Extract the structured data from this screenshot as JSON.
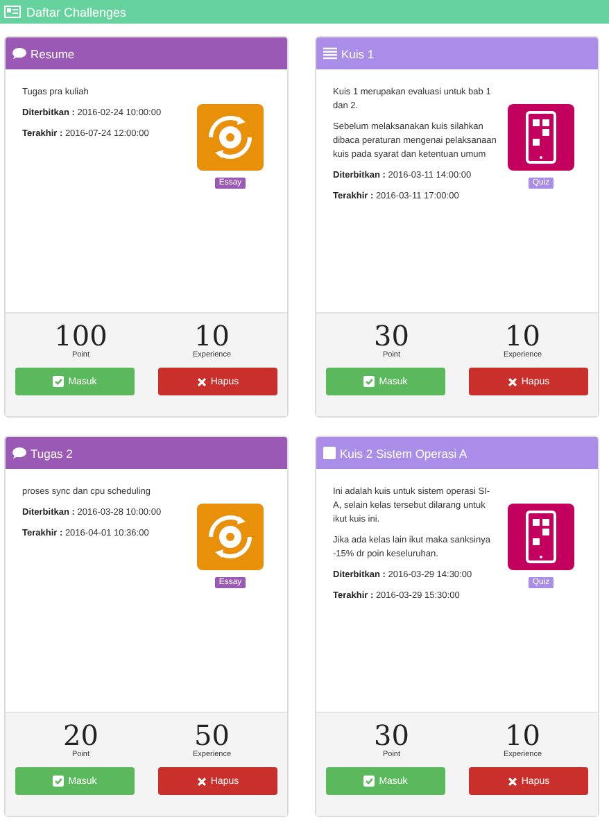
{
  "page_title": "Daftar Challenges",
  "cards": [
    {
      "header": {
        "kind": "comment",
        "title": "Resume"
      },
      "kind": "essay",
      "paragraphs": [
        "Tugas pra kuliah"
      ],
      "published": "**Diterbitkan :** 2016-02-24 10:00:00",
      "deadline": "**Terakhir :** 2016-07-24 12:00:00",
      "badge": "Essay",
      "points": "100",
      "points_label": "Point",
      "experience": "10",
      "experience_label": "Experience",
      "buttons": [
        "Masuk",
        "Hapus"
      ]
    },
    {
      "header": {
        "kind": "list",
        "title": "Kuis 1"
      },
      "kind": "quiz",
      "paragraphs": [
        "Kuis 1 merupakan evaluasi untuk bab 1 dan 2.",
        "Sebelum melaksanakan kuis silahkan dibaca peraturan mengenai pelaksanaan kuis pada syarat dan ketentuan umum"
      ],
      "published": "**Diterbitkan :** 2016-03-11 14:00:00",
      "deadline": "**Terakhir :** 2016-03-11 17:00:00",
      "badge": "Quiz",
      "points": "30",
      "points_label": "Point",
      "experience": "10",
      "experience_label": "Experience",
      "buttons": [
        "Masuk",
        "Hapus"
      ]
    },
    {
      "header": {
        "kind": "comment",
        "title": "Tugas 2"
      },
      "kind": "essay",
      "paragraphs": [
        "proses sync dan cpu scheduling"
      ],
      "published": "**Diterbitkan :** 2016-03-28 10:00:00",
      "deadline": "**Terakhir :** 2016-04-01 10:36:00",
      "badge": "Essay",
      "points": "20",
      "points_label": "Point",
      "experience": "50",
      "experience_label": "Experience",
      "buttons": [
        "Masuk",
        "Hapus"
      ]
    },
    {
      "header": {
        "kind": "square",
        "title": "Kuis 2 Sistem Operasi A"
      },
      "kind": "quiz",
      "paragraphs": [
        "Ini adalah kuis untuk sistem operasi SI-A, selain kelas tersebut dilarang untuk ikut kuis ini.",
        "Jika ada kelas lain ikut maka sanksinya -15% dr poin keseluruhan."
      ],
      "published": "**Diterbitkan :** 2016-03-29 14:30:00",
      "deadline": "**Terakhir :** 2016-03-29 15:30:00",
      "badge": "Quiz",
      "points": "30",
      "points_label": "Point",
      "experience": "10",
      "experience_label": "Experience",
      "buttons": [
        "Masuk",
        "Hapus"
      ]
    }
  ]
}
